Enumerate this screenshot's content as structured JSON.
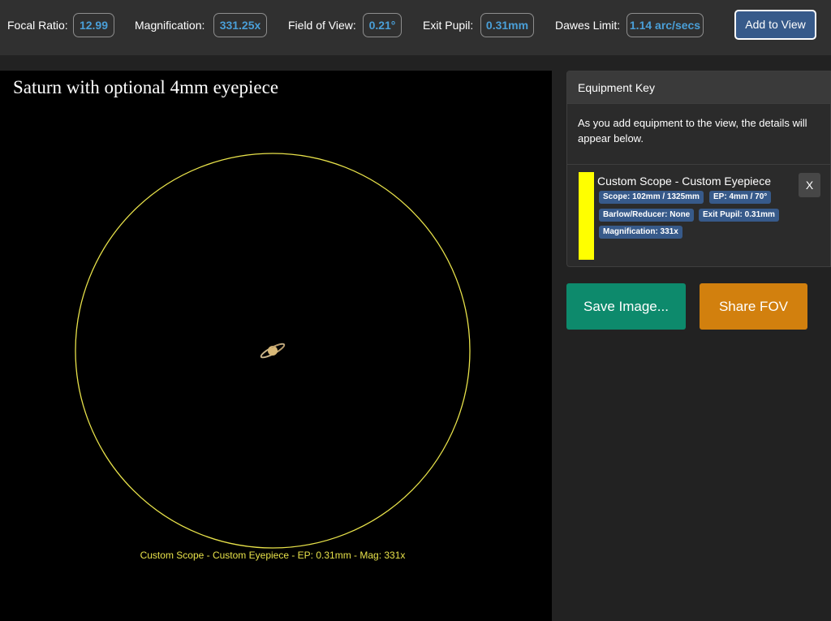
{
  "stats": {
    "focal_ratio": {
      "label": "Focal Ratio:",
      "value": "12.99"
    },
    "magnification": {
      "label": "Magnification:",
      "value": "331.25x"
    },
    "field_of_view": {
      "label": "Field of View:",
      "value": "0.21°"
    },
    "exit_pupil": {
      "label": "Exit Pupil:",
      "value": "0.31mm"
    },
    "dawes_limit": {
      "label": "Dawes Limit:",
      "value": "1.14 arc/secs"
    }
  },
  "add_to_view_label": "Add to View",
  "view": {
    "title": "Saturn with optional 4mm eyepiece",
    "caption": "Custom Scope - Custom Eyepiece - EP: 0.31mm - Mag: 331x",
    "circle_color": "#e8e24a",
    "background": "#000000"
  },
  "equipment_key": {
    "header": "Equipment Key",
    "description": "As you add equipment to the view, the details will appear below.",
    "items": [
      {
        "title": "Custom Scope - Custom Eyepiece",
        "color": "#ffff00",
        "close_label": "X",
        "tags": {
          "scope": "Scope: 102mm / 1325mm",
          "eyepiece": "EP: 4mm / 70°",
          "barlow": "Barlow/Reducer: None",
          "exit_pupil": "Exit Pupil: 0.31mm",
          "magnification": "Magnification: 331x"
        }
      }
    ]
  },
  "actions": {
    "save_label": "Save Image...",
    "share_label": "Share FOV"
  },
  "colors": {
    "accent_blue": "#375a8a",
    "stat_text": "#4a9fd8",
    "save_green": "#0d8a6c",
    "share_orange": "#d2800e"
  }
}
